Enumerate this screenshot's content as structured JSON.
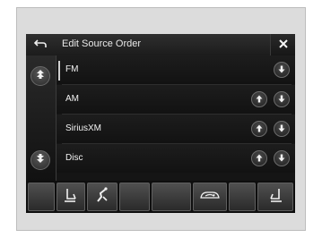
{
  "header": {
    "title": "Edit Source Order"
  },
  "sources": [
    {
      "label": "FM",
      "selected": true,
      "controls": [
        "down"
      ]
    },
    {
      "label": "AM",
      "selected": false,
      "controls": [
        "up",
        "down"
      ]
    },
    {
      "label": "SiriusXM",
      "selected": false,
      "controls": [
        "up",
        "down"
      ]
    },
    {
      "label": "Disc",
      "selected": false,
      "controls": [
        "up",
        "down"
      ]
    }
  ],
  "icons": {
    "back": "back-arrow-icon",
    "close": "close-icon",
    "scroll_up": "scroll-up-icon",
    "scroll_down": "scroll-down-icon",
    "move_up": "arrow-up-icon",
    "move_down": "arrow-down-icon",
    "driver_seat_heater": "seat-heater-icon",
    "driver_heated_steering": "heated-steering-icon",
    "recirculation": "recirculation-icon",
    "passenger_seat_heater": "seat-heater-icon"
  },
  "colors": {
    "screen_bg": "#151515",
    "text": "#f2f2f2",
    "frame": "#dcdcdc"
  }
}
